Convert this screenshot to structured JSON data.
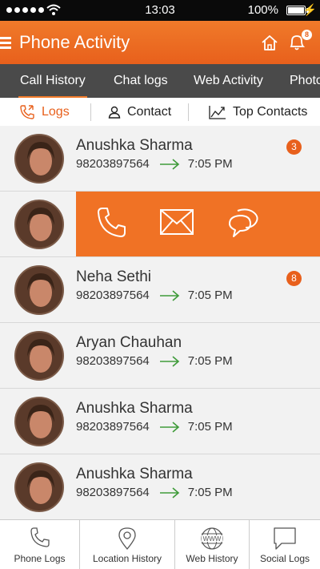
{
  "status_bar": {
    "time": "13:03",
    "battery": "100%"
  },
  "header": {
    "title": "Phone Activity",
    "notification_count": "8"
  },
  "tabs": [
    {
      "label": "Call History"
    },
    {
      "label": "Chat logs"
    },
    {
      "label": "Web Activity"
    },
    {
      "label": "Photo"
    }
  ],
  "subtabs": [
    {
      "label": "Logs"
    },
    {
      "label": "Contact"
    },
    {
      "label": "Top Contacts"
    }
  ],
  "calls": [
    {
      "name": "Anushka Sharma",
      "number": "98203897564",
      "time": "7:05 PM",
      "count": "3"
    },
    {
      "name": "Neha Sethi",
      "number": "98203897564",
      "time": "7:05 PM",
      "count": "8"
    },
    {
      "name": "Aryan Chauhan",
      "number": "98203897564",
      "time": "7:05 PM",
      "count": ""
    },
    {
      "name": "Anushka Sharma",
      "number": "98203897564",
      "time": "7:05 PM",
      "count": ""
    },
    {
      "name": "Anushka Sharma",
      "number": "98203897564",
      "time": "7:05 PM",
      "count": ""
    }
  ],
  "swipe_actions": [
    "phone-icon",
    "mail-icon",
    "chat-icon"
  ],
  "bottom_nav": [
    {
      "label": "Phone Logs"
    },
    {
      "label": "Location History"
    },
    {
      "label": "Web History"
    },
    {
      "label": "Social Logs"
    }
  ],
  "colors": {
    "accent": "#f07225",
    "tabbar": "#4a4a4a",
    "row_bg": "#f2f2f2",
    "outgoing_arrow": "#3f9b3a"
  }
}
